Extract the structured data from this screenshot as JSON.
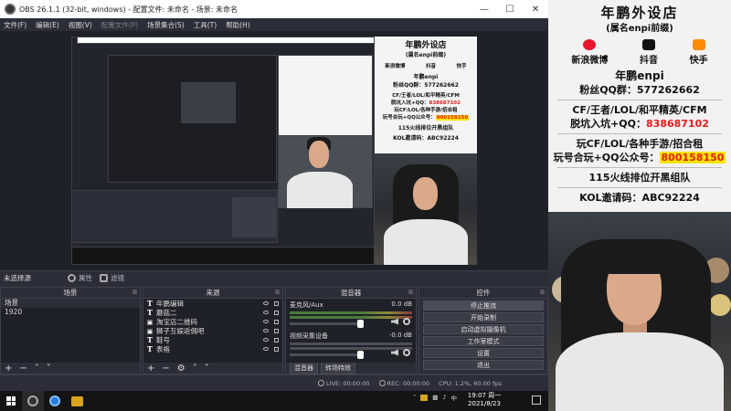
{
  "window": {
    "title": "OBS 26.1.1 (32-bit, windows) - 配置文件: 未命名 - 场景: 未命名"
  },
  "menu": {
    "items": [
      "文件(F)",
      "编辑(E)",
      "视图(V)",
      "配置文件(P)",
      "场景集合(S)",
      "工具(T)",
      "帮助(H)"
    ]
  },
  "strip": {
    "no_source": "未选择源",
    "properties": "属性",
    "filters": "滤镜"
  },
  "scenes": {
    "title": "场景",
    "header_col": "场景",
    "items": [
      "1920"
    ]
  },
  "sources": {
    "title": "来源",
    "items": [
      "年鹏编辑",
      "蘑菇二",
      "淘宝店二维码",
      "狮子互娱返佣吧",
      "鞋号",
      "表格"
    ]
  },
  "mixer": {
    "title": "混音器",
    "channels": [
      {
        "name": "麦克风/Aux",
        "db": "0.0 dB"
      },
      {
        "name": "视频采集设备",
        "db": "-0.0 dB"
      }
    ],
    "tabs": [
      "混音器",
      "转场特效"
    ]
  },
  "controls": {
    "title": "控件",
    "buttons": [
      "停止推流",
      "开始录制",
      "启动虚拟摄像机",
      "工作室模式",
      "设置",
      "退出"
    ]
  },
  "status": {
    "live": "LIVE: 00:00:00",
    "rec": "REC: 00:00:00",
    "cpu": "CPU: 1.2%, 60.00 fps"
  },
  "taskbar": {
    "time": "19:07 周一",
    "date": "2021/8/23"
  },
  "overlay": {
    "title": "年鹏外设店",
    "subtitle": "(属名enpi前缀)",
    "socials": [
      {
        "label": "新浪微博",
        "icon": "weibo-icon",
        "color": "#e6162d"
      },
      {
        "label": "抖音",
        "icon": "douyin-icon",
        "color": "#111111"
      },
      {
        "label": "快手",
        "icon": "kuaishou-icon",
        "color": "#ff8a00"
      }
    ],
    "name_line": "年鹏enpi",
    "fans_line": "粉丝QQ群：577262662",
    "game_line": "CF/王者/LOL/和平精英/CFM",
    "qq_prefix": "脱坑入坑+QQ：",
    "qq_num": "838687102",
    "rent_line": "玩CF/LOL/各种手游/招合租",
    "wx_prefix": "玩号合玩+QQ公众号：",
    "wx_num": "800158150",
    "team_line": "115火线排位开黑组队",
    "code_line": "KOL邀请码：ABC92224"
  }
}
